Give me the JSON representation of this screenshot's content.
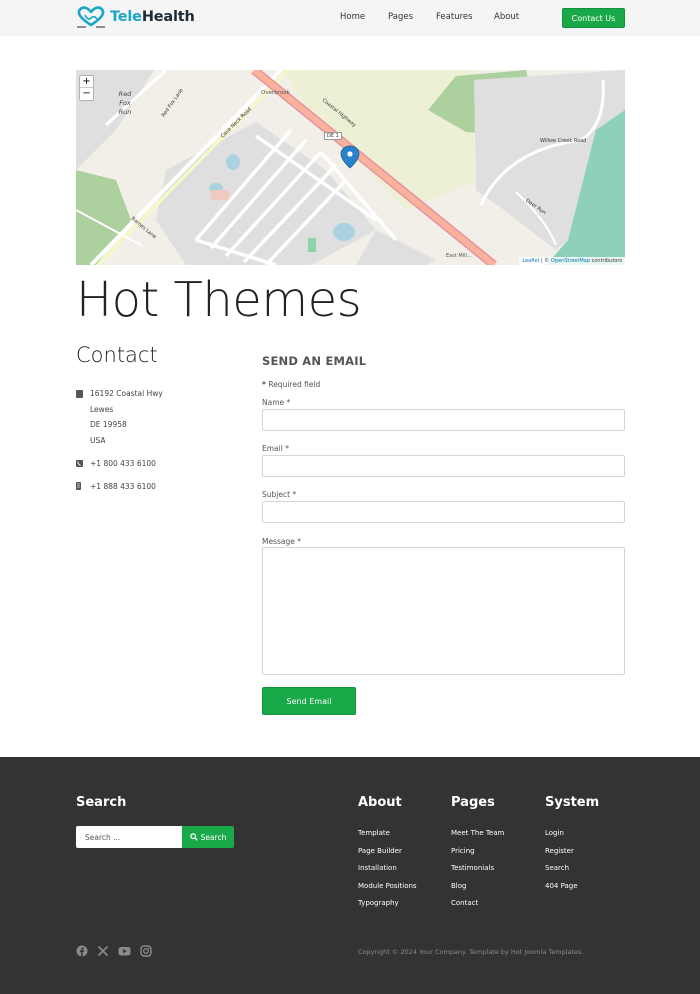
{
  "header": {
    "logo": {
      "part1": "Tele",
      "part2": "Health"
    },
    "nav": [
      "Home",
      "Pages",
      "Features",
      "About"
    ],
    "cta": "Contact Us"
  },
  "map": {
    "zoom_in": "+",
    "zoom_out": "−",
    "attribution": {
      "leaflet": "Leaflet",
      "sep": " | © ",
      "osm": "OpenStreetMap",
      "contrib": " contributors"
    },
    "labels": {
      "red_fox_run": "Red Fox Run",
      "red_fox_lane": "Red Fox Lane",
      "overbrook": "Overbrook",
      "coastal_hwy": "Coastal Highway",
      "de1": "DE 1",
      "cave_neck": "Cave Neck Road",
      "willow_creek": "Willow Creek Road",
      "deer_run": "Deer Run",
      "east_mill": "East Mill...",
      "barnes": "Barnes Lane"
    },
    "colors": {
      "land": "#f2efe9",
      "residential": "#e0dfdf",
      "park": "#add19e",
      "farmland": "#eef0d5",
      "trunk": "#f9b29c",
      "wetland": "#8ed1b8"
    }
  },
  "page_title": "Hot Themes",
  "contact": {
    "heading": "Contact",
    "address": [
      "16192 Coastal Hwy",
      "Lewes",
      "DE 19958",
      "USA"
    ],
    "phone": "+1 800 433 6100",
    "mobile": "+1 888 433 6100"
  },
  "form": {
    "heading": "SEND AN EMAIL",
    "required_star": "*",
    "required_note": " Required field",
    "name_label": "Name *",
    "email_label": "Email *",
    "subject_label": "Subject *",
    "message_label": "Message *",
    "submit": "Send Email"
  },
  "footer": {
    "search_heading": "Search",
    "search_placeholder": "Search ...",
    "search_button": "Search",
    "about": {
      "heading": "About",
      "links": [
        "Template",
        "Page Builder",
        "Installation",
        "Module Positions",
        "Typography"
      ]
    },
    "pages": {
      "heading": "Pages",
      "links": [
        "Meet The Team",
        "Pricing",
        "Testimonials",
        "Blog",
        "Contact"
      ]
    },
    "system": {
      "heading": "System",
      "links": [
        "Login",
        "Register",
        "Search",
        "404 Page"
      ]
    },
    "copyright": "Copyright © 2024 Your Company. Template by Hot Joomla Templates."
  },
  "brand_colors": {
    "green": "#1aa948",
    "teal": "#17a6c9",
    "footer_bg": "#333333"
  },
  "icons": [
    "heart-stethoscope-logo-icon",
    "address-card-icon",
    "phone-icon",
    "mobile-icon",
    "search-icon",
    "map-marker-icon",
    "facebook-icon",
    "x-icon",
    "youtube-icon",
    "instagram-icon"
  ]
}
